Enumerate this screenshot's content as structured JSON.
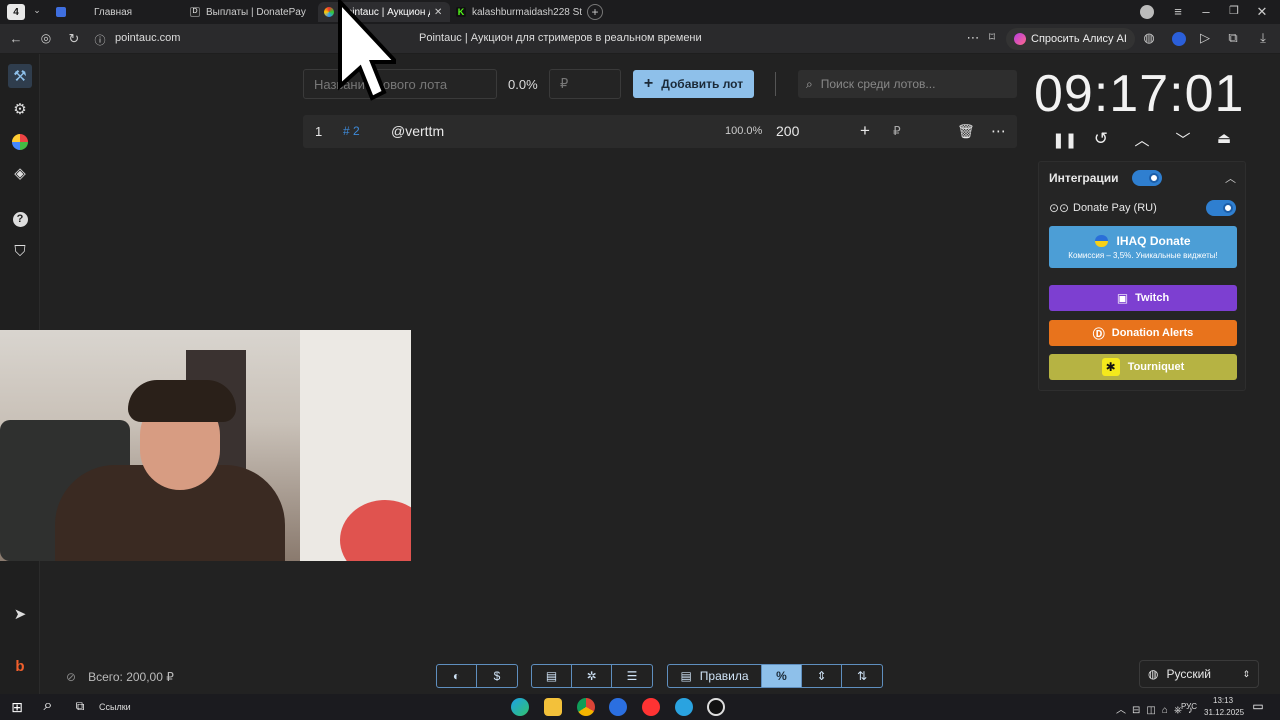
{
  "browser": {
    "tab_count": "4",
    "tabs": [
      {
        "label": "Главная"
      },
      {
        "label": "Выплаты | DonatePay"
      },
      {
        "label": "Pointauc | Аукцион дл..."
      },
      {
        "label": "kalashburmaidash228 Stre..."
      }
    ],
    "address": "pointauc.com",
    "page_title": "Pointauc | Аукцион для стримеров в реальном времени",
    "alice_label": "Спросить Алису AI"
  },
  "toolbar": {
    "lot_placeholder": "Название нового лота",
    "percent": "0.0%",
    "currency_placeholder": "₽",
    "add_lot_label": "Добавить лот",
    "search_placeholder": "Поиск среди лотов..."
  },
  "lots": [
    {
      "index": "1",
      "id": "# 2",
      "name": "@verttm",
      "percent": "100.0%",
      "amount": "200",
      "currency": "₽"
    }
  ],
  "timer": {
    "value": "09:17:01"
  },
  "integrations": {
    "title": "Интеграции",
    "enabled": true,
    "donatepay_label": "Donate Pay (RU)",
    "donatepay_enabled": true,
    "ihaq_label": "IHAQ Donate",
    "ihaq_sub": "Комиссия – 3,5%. Уникальные виджеты!",
    "twitch_label": "Twitch",
    "donation_alerts_label": "Donation Alerts",
    "tourniquet_label": "Tourniquet"
  },
  "footer": {
    "total_label": "Всего: 200,00 ₽",
    "rules_label": "Правила",
    "language": "Русский"
  },
  "taskbar": {
    "links_label": "Ссылки",
    "lang": "РУС",
    "time": "13:13",
    "date": "31.12.2025"
  },
  "colors": {
    "accent": "#8ec0ea",
    "twitch": "#7d3fd1",
    "donation_alerts": "#e8731c",
    "tourniquet": "#b6b343",
    "ihaq": "#4c9ed6"
  }
}
